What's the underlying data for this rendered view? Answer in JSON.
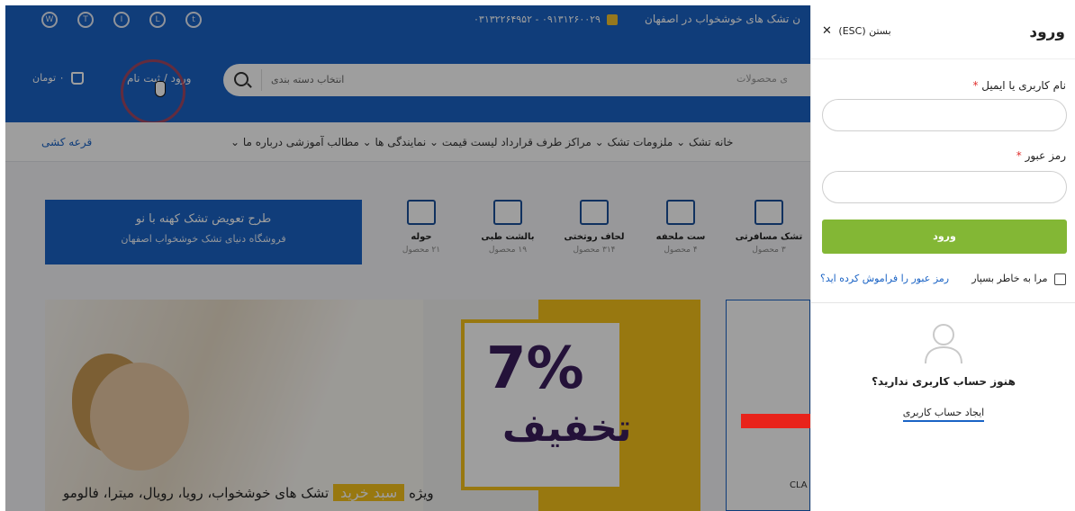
{
  "topbar": {
    "socials": [
      "whatsapp-icon",
      "telegram-icon",
      "instagram-icon",
      "location-icon",
      "twitter-icon"
    ],
    "phone": "۰۹۱۳۱۲۶۰۰۲۹ - ۰۳۱۳۲۲۶۴۹۵۲",
    "store_name": "ن تشک های خوشخواب در اصفهان"
  },
  "header": {
    "search_placeholder": "ی محصولات",
    "category_select": "انتخاب دسته بندی",
    "account_link": "ورود / ثبت نام",
    "cart_total": "۰ تومان"
  },
  "nav": {
    "lottery": "قرعه کشی",
    "items": "خانه   تشک ⌄   ملزومات تشک ⌄   مراکز طرف قرارداد   لیست قیمت ⌄   نمایندگی ها ⌄   مطالب آموزشی   درباره ما ⌄"
  },
  "promo": {
    "title": "طرح تعویض تشک کهنه با نو",
    "subtitle": "فروشگاه دنیای تشک خوشخواب اصفهان"
  },
  "categories": [
    {
      "name": "تشک مسافرتی",
      "count": "۳ محصول"
    },
    {
      "name": "ست ملحفه",
      "count": "۴ محصول"
    },
    {
      "name": "لحاف روتختی",
      "count": "۳۱۴ محصول"
    },
    {
      "name": "بالشت طبی",
      "count": "۱۹ محصول"
    },
    {
      "name": "حوله",
      "count": "۲۱ محصول"
    }
  ],
  "banner": {
    "percent": "7%",
    "discount": "تخفیف",
    "special": "ویژه",
    "cart_button": "سبد خرید",
    "brands": "تشک های خوشخواب، رویا، رویال، میترا، فالومو",
    "side_text": "CLA"
  },
  "login": {
    "title": "ورود",
    "close_label": "بستن (ESC)",
    "username_label": "نام کاربری یا ایمیل",
    "password_label": "رمز عبور",
    "required_mark": "*",
    "login_button": "ورود",
    "remember_me": "مرا به خاطر بسپار",
    "forgot_password": "رمز عبور را فراموش کرده اید؟",
    "no_account": "هنوز حساب کاربری ندارید؟",
    "create_account": "ایجاد حساب کاربری"
  },
  "colors": {
    "brand_blue": "#1a63c5",
    "login_green": "#83b735",
    "required_red": "#e0302e",
    "arrow_red": "#e8231b",
    "accent_yellow": "#f5c21b"
  }
}
